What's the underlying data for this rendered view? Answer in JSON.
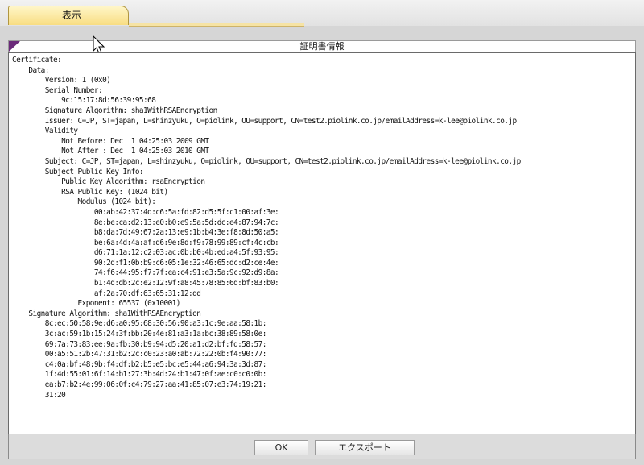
{
  "tab": {
    "label": "表示"
  },
  "dialog": {
    "title": "証明書情報",
    "certificate_text": "Certificate:\n    Data:\n        Version: 1 (0x0)\n        Serial Number:\n            9c:15:17:8d:56:39:95:68\n        Signature Algorithm: sha1WithRSAEncryption\n        Issuer: C=JP, ST=japan, L=shinzyuku, O=piolink, OU=support, CN=test2.piolink.co.jp/emailAddress=k-lee@piolink.co.jp\n        Validity\n            Not Before: Dec  1 04:25:03 2009 GMT\n            Not After : Dec  1 04:25:03 2010 GMT\n        Subject: C=JP, ST=japan, L=shinzyuku, O=piolink, OU=support, CN=test2.piolink.co.jp/emailAddress=k-lee@piolink.co.jp\n        Subject Public Key Info:\n            Public Key Algorithm: rsaEncryption\n            RSA Public Key: (1024 bit)\n                Modulus (1024 bit):\n                    00:ab:42:37:4d:c6:5a:fd:82:d5:5f:c1:00:af:3e:\n                    8e:be:ca:d2:13:e0:b0:e9:5a:5d:dc:e4:87:94:7c:\n                    b8:da:7d:49:67:2a:13:e9:1b:b4:3e:f8:8d:50:a5:\n                    be:6a:4d:4a:af:d6:9e:8d:f9:78:99:89:cf:4c:cb:\n                    d6:71:1a:12:c2:03:ac:0b:b0:4b:ed:a4:5f:93:95:\n                    90:2d:f1:0b:b9:c6:05:1e:32:46:65:dc:d2:ce:4e:\n                    74:f6:44:95:f7:7f:ea:c4:91:e3:5a:9c:92:d9:8a:\n                    b1:4d:db:2c:e2:12:9f:a8:45:78:85:6d:bf:83:b0:\n                    af:2a:70:df:63:65:31:12:dd\n                Exponent: 65537 (0x10001)\n    Signature Algorithm: sha1WithRSAEncryption\n        8c:ec:50:58:9e:d6:a0:95:68:30:56:90:a3:1c:9e:aa:58:1b:\n        3c:ac:59:1b:15:24:3f:bb:20:4e:81:a3:1a:bc:38:89:58:0e:\n        69:7a:73:83:ee:9a:fb:30:b9:94:d5:20:a1:d2:bf:fd:58:57:\n        00:a5:51:2b:47:31:b2:2c:c0:23:a0:ab:72:22:0b:f4:90:77:\n        c4:0a:bf:48:9b:f4:df:b2:b5:e5:bc:e5:44:a6:94:3a:3d:87:\n        1f:4d:55:01:6f:14:b1:27:3b:4d:24:b1:47:0f:ae:c0:c0:0b:\n        ea:b7:b2:4e:99:06:0f:c4:79:27:aa:41:85:07:e3:74:19:21:\n        31:20"
  },
  "buttons": {
    "ok": "OK",
    "export": "エクスポート"
  },
  "icons": {
    "header_corner": "purple-corner-triangle-icon",
    "cursor": "mouse-pointer-icon"
  },
  "colors": {
    "corner_accent": "#6b2a7a",
    "tab_fill": "#f8dd82"
  }
}
